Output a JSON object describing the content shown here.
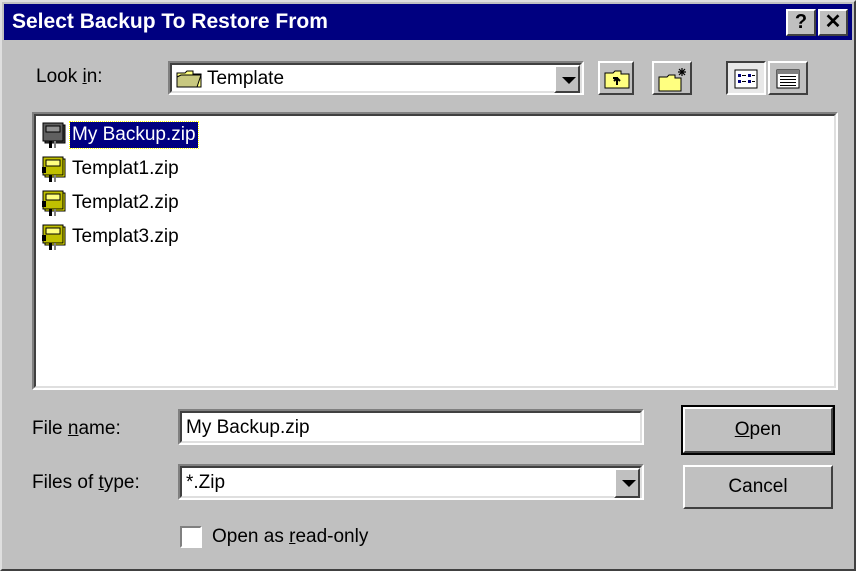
{
  "window": {
    "title": "Select Backup To Restore From",
    "help_glyph": "?",
    "close_glyph": "✕"
  },
  "lookin": {
    "label_pre": "Look ",
    "label_ul": "i",
    "label_post": "n:",
    "value": "Template",
    "folder_icon": "folder-icon"
  },
  "toolbar": {
    "buttons": [
      "up-one-level-icon",
      "create-new-folder-icon",
      "list-view-icon",
      "details-view-icon"
    ]
  },
  "files": [
    {
      "name": "My Backup.zip",
      "selected": true
    },
    {
      "name": "Templat1.zip",
      "selected": false
    },
    {
      "name": "Templat2.zip",
      "selected": false
    },
    {
      "name": "Templat3.zip",
      "selected": false
    }
  ],
  "filename": {
    "label_pre": "File ",
    "label_ul": "n",
    "label_post": "ame:",
    "value": "My Backup.zip"
  },
  "filetype": {
    "label_pre": "Files of ",
    "label_ul": "t",
    "label_post": "ype:",
    "value": "*.Zip"
  },
  "buttons": {
    "open_ul": "O",
    "open_rest": "pen",
    "cancel": "Cancel"
  },
  "readonly": {
    "label_pre": "Open as ",
    "label_ul": "r",
    "label_post": "ead-only",
    "checked": false
  },
  "colors": {
    "titlebar": "#000080",
    "face": "#c0c0c0",
    "selection": "#000080"
  }
}
